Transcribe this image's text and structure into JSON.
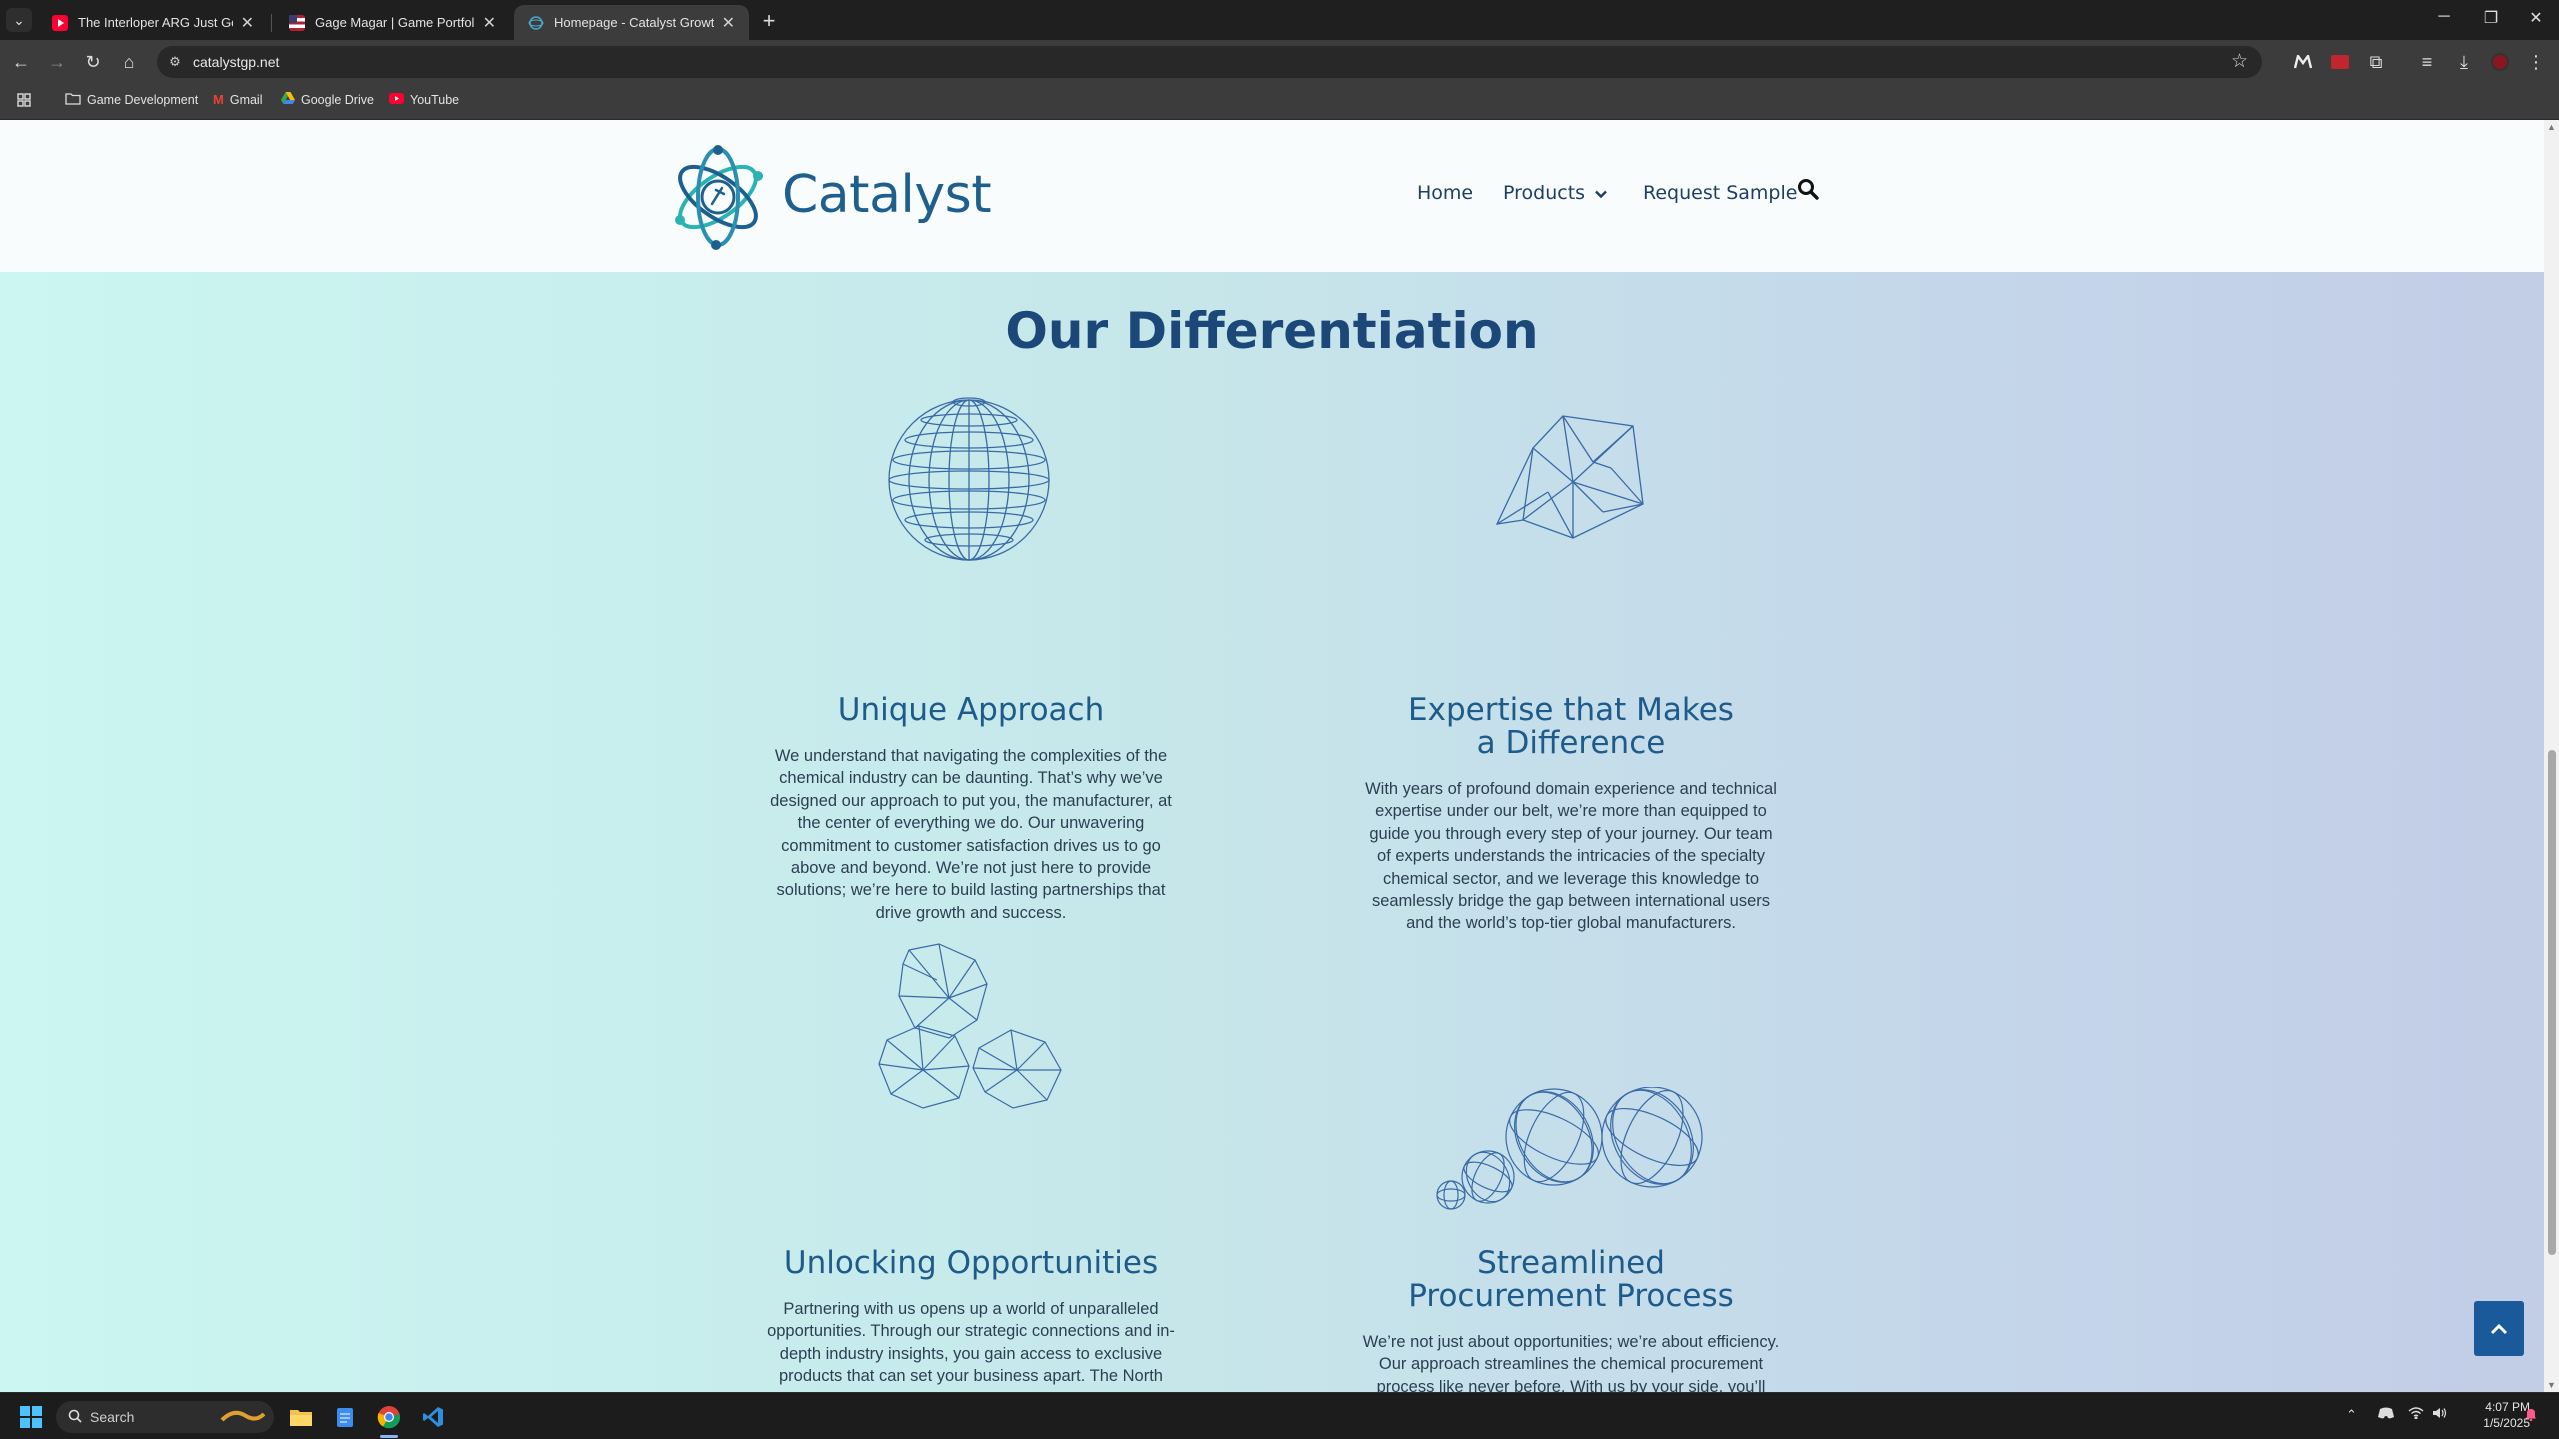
{
  "browser": {
    "tabs": [
      {
        "title": "The Interloper ARG Just Got Mo",
        "favicon": "youtube-icon",
        "active": false
      },
      {
        "title": "Gage Magar | Game Portfolio",
        "favicon": "flag-icon",
        "active": false
      },
      {
        "title": "Homepage - Catalyst Growth P",
        "favicon": "catalyst-icon",
        "active": true
      }
    ],
    "url": "catalystgp.net",
    "bookmarks": [
      {
        "label": "Game Development",
        "icon": "folder-icon"
      },
      {
        "label": "Gmail",
        "icon": "gmail-icon"
      },
      {
        "label": "Google Drive",
        "icon": "drive-icon"
      },
      {
        "label": "YouTube",
        "icon": "youtube-icon"
      }
    ]
  },
  "site": {
    "logo_text": "Catalyst",
    "nav": {
      "home": "Home",
      "products": "Products",
      "request_sample": "Request Sample"
    },
    "section_title": "Our Differentiation",
    "features": [
      {
        "title": "Unique Approach",
        "icon": "wireframe-sphere-icon",
        "body": "We understand that navigating the complexities of the chemical industry can be daunting. That’s why we’ve designed our approach to put you, the manufacturer, at the center of everything we do. Our unwavering commitment to customer satisfaction drives us to go above and beyond. We’re not just here to provide solutions; we’re here to build lasting partnerships that drive growth and success."
      },
      {
        "title": "Expertise that Makes a Difference",
        "icon": "wireframe-polyhedron-icon",
        "body": "With years of profound domain experience and technical expertise under our belt, we’re more than equipped to guide you through every step of your journey. Our team of experts understands the intricacies of the specialty chemical sector, and we leverage this knowledge to seamlessly bridge the gap between international users and the world’s top-tier global manufacturers."
      },
      {
        "title": "Unlocking Opportunities",
        "icon": "wireframe-rocks-icon",
        "body": "Partnering with us opens up a world of unparalleled opportunities. Through our strategic connections and in-depth industry insights, you gain access to exclusive products that can set your business apart. The North American market, renowned for its potential, becomes easily accessible with our guidance and support."
      },
      {
        "title": "Streamlined Procurement Process",
        "icon": "wireframe-spheres-icon",
        "body": "We’re not just about opportunities; we’re about efficiency. Our approach streamlines the chemical procurement process like never before. With us by your side, you’ll experience a smoother, more transparent process that saves you time and resources, allowing you to focus on what you do best – innovation and production."
      }
    ]
  },
  "taskbar": {
    "search_label": "Search",
    "time": "4:07 PM",
    "date": "1/5/2025"
  },
  "colors": {
    "brand_blue": "#1b4878",
    "accent_teal": "#2bb3b1",
    "back_to_top": "#1a5a9a"
  }
}
